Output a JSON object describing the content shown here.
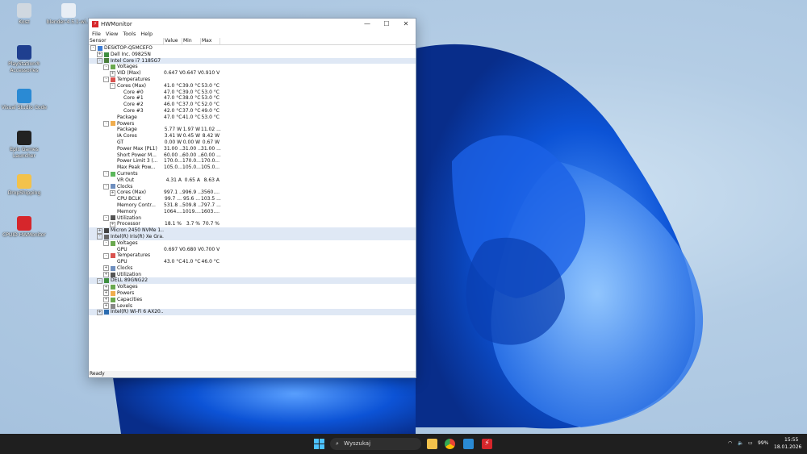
{
  "desktop": {
    "icons": [
      {
        "label": "Kosz",
        "glyph": "recycle-bin-icon",
        "color": "#d0d8e0"
      },
      {
        "label": "blender-4.5.1-wi...",
        "glyph": "installer-icon",
        "color": "#e8eef5"
      },
      {
        "label": "PlayStation® Accessories",
        "glyph": "playstation-icon",
        "color": "#1f3f8f"
      },
      {
        "label": "Visual Studio Code",
        "glyph": "vscode-icon",
        "color": "#2a8ad4"
      },
      {
        "label": "Epic Games Launcher",
        "glyph": "epic-icon",
        "color": "#222222"
      },
      {
        "label": "DropShipping",
        "glyph": "folder-icon",
        "color": "#f3c24b"
      },
      {
        "label": "CPUID HWMonitor",
        "glyph": "hwmonitor-icon",
        "color": "#d6262b"
      }
    ]
  },
  "window": {
    "title": "HWMonitor",
    "menu": [
      "File",
      "View",
      "Tools",
      "Help"
    ],
    "columns": [
      "Sensor",
      "Value",
      "Min",
      "Max"
    ],
    "status": "Ready"
  },
  "tree": [
    {
      "level": 0,
      "exp": "-",
      "icon": "computer",
      "name": "DESKTOP-Q5MCEFO",
      "v": "",
      "mn": "",
      "mx": "",
      "hl": false
    },
    {
      "level": 1,
      "exp": "+",
      "icon": "board",
      "name": "Dell Inc. 09825N",
      "v": "",
      "mn": "",
      "mx": "",
      "hl": false
    },
    {
      "level": 1,
      "exp": "-",
      "icon": "cpu",
      "name": "Intel Core i7 1185G7",
      "v": "",
      "mn": "",
      "mx": "",
      "hl": true
    },
    {
      "level": 2,
      "exp": "-",
      "icon": "volt",
      "name": "Voltages",
      "v": "",
      "mn": "",
      "mx": "",
      "hl": false
    },
    {
      "level": 3,
      "exp": "+",
      "icon": "",
      "name": "VID (Max)",
      "v": "0.647 V",
      "mn": "0.647 V",
      "mx": "0.910 V",
      "hl": false
    },
    {
      "level": 2,
      "exp": "-",
      "icon": "temp",
      "name": "Temperatures",
      "v": "",
      "mn": "",
      "mx": "",
      "hl": false
    },
    {
      "level": 3,
      "exp": "-",
      "icon": "",
      "name": "Cores (Max)",
      "v": "41.0 °C",
      "mn": "39.0 °C",
      "mx": "53.0 °C",
      "hl": false
    },
    {
      "level": 4,
      "exp": "",
      "icon": "",
      "name": "Core #0",
      "v": "47.0 °C",
      "mn": "39.0 °C",
      "mx": "53.0 °C",
      "hl": false
    },
    {
      "level": 4,
      "exp": "",
      "icon": "",
      "name": "Core #1",
      "v": "47.0 °C",
      "mn": "38.0 °C",
      "mx": "53.0 °C",
      "hl": false
    },
    {
      "level": 4,
      "exp": "",
      "icon": "",
      "name": "Core #2",
      "v": "46.0 °C",
      "mn": "37.0 °C",
      "mx": "52.0 °C",
      "hl": false
    },
    {
      "level": 4,
      "exp": "",
      "icon": "",
      "name": "Core #3",
      "v": "42.0 °C",
      "mn": "37.0 °C",
      "mx": "49.0 °C",
      "hl": false
    },
    {
      "level": 3,
      "exp": "",
      "icon": "",
      "name": "Package",
      "v": "47.0 °C",
      "mn": "41.0 °C",
      "mx": "53.0 °C",
      "hl": false
    },
    {
      "level": 2,
      "exp": "-",
      "icon": "power",
      "name": "Powers",
      "v": "",
      "mn": "",
      "mx": "",
      "hl": false
    },
    {
      "level": 3,
      "exp": "",
      "icon": "",
      "name": "Package",
      "v": "5.77 W",
      "mn": "1.97 W",
      "mx": "11.02 ...",
      "hl": false
    },
    {
      "level": 3,
      "exp": "",
      "icon": "",
      "name": "IA Cores",
      "v": "3.41 W",
      "mn": "0.45 W",
      "mx": "8.42 W",
      "hl": false
    },
    {
      "level": 3,
      "exp": "",
      "icon": "",
      "name": "GT",
      "v": "0.00 W",
      "mn": "0.00 W",
      "mx": "0.67 W",
      "hl": false
    },
    {
      "level": 3,
      "exp": "",
      "icon": "",
      "name": "Power Max (PL1)",
      "v": "31.00 ...",
      "mn": "31.00 ...",
      "mx": "31.00 ...",
      "hl": false
    },
    {
      "level": 3,
      "exp": "",
      "icon": "",
      "name": "Short Power M...",
      "v": "60.00 ...",
      "mn": "60.00 ...",
      "mx": "60.00 ...",
      "hl": false
    },
    {
      "level": 3,
      "exp": "",
      "icon": "",
      "name": "Power Limit 3 (...",
      "v": "170.0...",
      "mn": "170.0...",
      "mx": "170.0...",
      "hl": false
    },
    {
      "level": 3,
      "exp": "",
      "icon": "",
      "name": "Max Peak Pow...",
      "v": "105.0...",
      "mn": "105.0...",
      "mx": "105.0...",
      "hl": false
    },
    {
      "level": 2,
      "exp": "-",
      "icon": "current",
      "name": "Currents",
      "v": "",
      "mn": "",
      "mx": "",
      "hl": false
    },
    {
      "level": 3,
      "exp": "",
      "icon": "",
      "name": "VR Out",
      "v": "4.31 A",
      "mn": "0.65 A",
      "mx": "8.63 A",
      "hl": false
    },
    {
      "level": 2,
      "exp": "-",
      "icon": "clock",
      "name": "Clocks",
      "v": "",
      "mn": "",
      "mx": "",
      "hl": false
    },
    {
      "level": 3,
      "exp": "+",
      "icon": "",
      "name": "Cores (Max)",
      "v": "997.1 ...",
      "mn": "996.9 ...",
      "mx": "3560....",
      "hl": false
    },
    {
      "level": 3,
      "exp": "",
      "icon": "",
      "name": "CPU BCLK",
      "v": "99.7 ...",
      "mn": "95.6 ...",
      "mx": "103.5 ...",
      "hl": false
    },
    {
      "level": 3,
      "exp": "",
      "icon": "",
      "name": "Memory Contr...",
      "v": "531.8 ...",
      "mn": "509.8 ...",
      "mx": "797.7 ...",
      "hl": false
    },
    {
      "level": 3,
      "exp": "",
      "icon": "",
      "name": "Memory",
      "v": "1064....",
      "mn": "1019....",
      "mx": "1603....",
      "hl": false
    },
    {
      "level": 2,
      "exp": "-",
      "icon": "util",
      "name": "Utilization",
      "v": "",
      "mn": "",
      "mx": "",
      "hl": false
    },
    {
      "level": 3,
      "exp": "+",
      "icon": "",
      "name": "Processor",
      "v": "18.1 %",
      "mn": "3.7 %",
      "mx": "70.7 %",
      "hl": false
    },
    {
      "level": 1,
      "exp": "+",
      "icon": "disk",
      "name": "Micron 2450 NVMe 1...",
      "v": "",
      "mn": "",
      "mx": "",
      "hl": true
    },
    {
      "level": 1,
      "exp": "-",
      "icon": "gpu",
      "name": "Intel(R) Iris(R) Xe Gra...",
      "v": "",
      "mn": "",
      "mx": "",
      "hl": true
    },
    {
      "level": 2,
      "exp": "-",
      "icon": "volt",
      "name": "Voltages",
      "v": "",
      "mn": "",
      "mx": "",
      "hl": false
    },
    {
      "level": 3,
      "exp": "",
      "icon": "",
      "name": "GPU",
      "v": "0.697 V",
      "mn": "0.680 V",
      "mx": "0.700 V",
      "hl": false
    },
    {
      "level": 2,
      "exp": "-",
      "icon": "temp",
      "name": "Temperatures",
      "v": "",
      "mn": "",
      "mx": "",
      "hl": false
    },
    {
      "level": 3,
      "exp": "",
      "icon": "",
      "name": "GPU",
      "v": "43.0 °C",
      "mn": "41.0 °C",
      "mx": "46.0 °C",
      "hl": false
    },
    {
      "level": 2,
      "exp": "+",
      "icon": "clock",
      "name": "Clocks",
      "v": "",
      "mn": "",
      "mx": "",
      "hl": false
    },
    {
      "level": 2,
      "exp": "+",
      "icon": "util",
      "name": "Utilization",
      "v": "",
      "mn": "",
      "mx": "",
      "hl": false
    },
    {
      "level": 1,
      "exp": "-",
      "icon": "battery",
      "name": "DELL 89GNG22",
      "v": "",
      "mn": "",
      "mx": "",
      "hl": true
    },
    {
      "level": 2,
      "exp": "+",
      "icon": "volt",
      "name": "Voltages",
      "v": "",
      "mn": "",
      "mx": "",
      "hl": false
    },
    {
      "level": 2,
      "exp": "+",
      "icon": "power",
      "name": "Powers",
      "v": "",
      "mn": "",
      "mx": "",
      "hl": false
    },
    {
      "level": 2,
      "exp": "+",
      "icon": "cap",
      "name": "Capacities",
      "v": "",
      "mn": "",
      "mx": "",
      "hl": false
    },
    {
      "level": 2,
      "exp": "+",
      "icon": "level",
      "name": "Levels",
      "v": "",
      "mn": "",
      "mx": "",
      "hl": false
    },
    {
      "level": 1,
      "exp": "+",
      "icon": "net",
      "name": "Intel(R) Wi-Fi 6 AX20...",
      "v": "",
      "mn": "",
      "mx": "",
      "hl": true
    }
  ],
  "taskbar": {
    "search_placeholder": "Wyszukaj",
    "battery": "99%",
    "time": "15:55",
    "date": "18.01.2026"
  }
}
